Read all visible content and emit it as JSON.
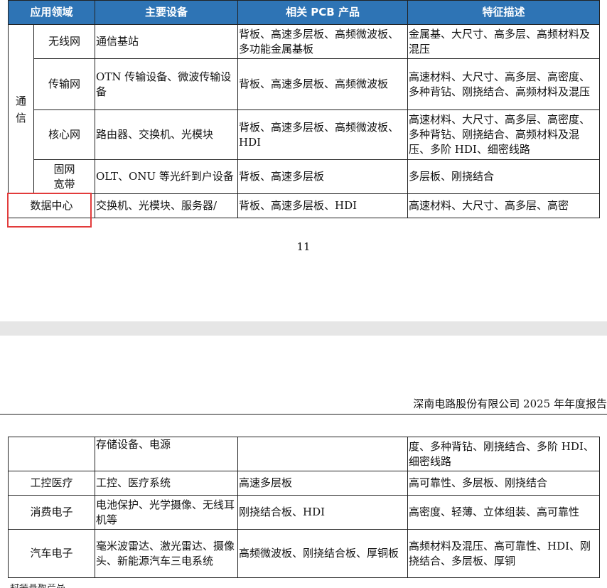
{
  "top_table": {
    "headers": [
      "应用领域",
      "主要设备",
      "相关 PCB 产品",
      "特征描述"
    ],
    "group_label": "通信",
    "rows": [
      {
        "sub": "无线网",
        "device": "通信基站",
        "pcb": "背板、高速多层板、高频微波板、多功能金属基板",
        "feature": "金属基、大尺寸、高多层、高频材料及混压"
      },
      {
        "sub": "传输网",
        "device": "OTN 传输设备、微波传输设备",
        "pcb": "背板、高速多层板、高频微波板",
        "feature": "高速材料、大尺寸、高多层、高密度、多种背钻、刚挠结合、高频材料及混压"
      },
      {
        "sub": "核心网",
        "device": "路由器、交换机、光模块",
        "pcb": "背板、高速多层板、高频微波板、HDI",
        "feature": "高速材料、大尺寸、高多层、高密度、多种背钻、刚挠结合、高频材料及混压、多阶 HDI、细密线路"
      },
      {
        "sub": "固网\n宽带",
        "device": "OLT、ONU 等光纤到户设备",
        "pcb": "背板、高速多层板",
        "feature": "多层板、刚挠结合"
      }
    ],
    "datacenter": {
      "label": "数据中心",
      "device": "交换机、光模块、服务器/",
      "pcb": "背板、高速多层板、HDI",
      "feature": "高速材料、大尺寸、高多层、高密"
    }
  },
  "page_number": "11",
  "header_text": "深南电路股份有限公司 2025 年年度报告",
  "bottom_table": {
    "rows": [
      {
        "label": "",
        "device": "存储设备、电源",
        "pcb": "",
        "feature": "度、多种背钻、刚挠结合、多阶 HDI、细密线路"
      },
      {
        "label": "工控医疗",
        "device": "工控、医疗系统",
        "pcb": "高速多层板",
        "feature": "高可靠性、多层板、刚挠结合"
      },
      {
        "label": "消费电子",
        "device": "电池保护、光学摄像、无线耳机等",
        "pcb": "刚挠结合板、HDI",
        "feature": "高密度、轻薄、立体组装、高可靠性"
      },
      {
        "label": "汽车电子",
        "device": "毫米波雷达、激光雷达、摄像头、新能源汽车三电系统",
        "pcb": "高频微波板、刚挠结合板、厚铜板",
        "feature": "高频材料及混压、高可靠性、HDI、刚挠结合、多层板、厚铜"
      }
    ]
  },
  "footer_fragment": "封装基板产品"
}
